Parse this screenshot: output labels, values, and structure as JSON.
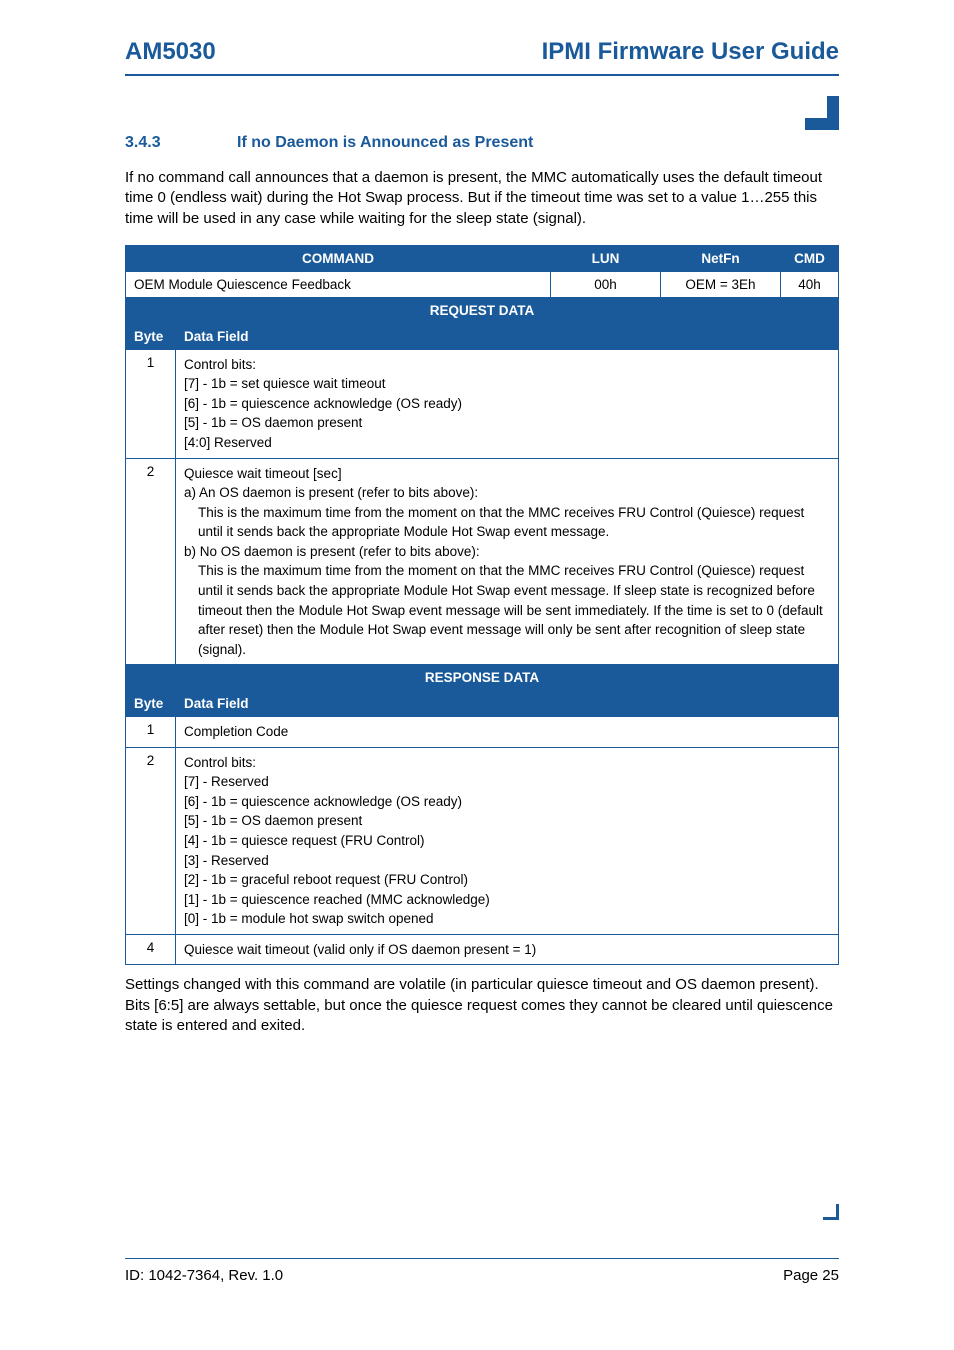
{
  "header": {
    "left": "AM5030",
    "right": "IPMI Firmware User Guide"
  },
  "section": {
    "num": "3.4.3",
    "title": "If no Daemon is Announced as Present"
  },
  "intro": "If no command call announces that a daemon is present, the MMC automatically uses the default timeout time 0 (endless wait) during the Hot Swap process. But if the timeout time was set to a value 1…255 this time will be used in any case while waiting for the sleep state (signal).",
  "table": {
    "hcols": {
      "c1": "COMMAND",
      "c2": "LUN",
      "c3": "NetFn",
      "c4": "CMD"
    },
    "row1": {
      "c1": "OEM Module Quiescence Feedback",
      "c2": "00h",
      "c3": "OEM = 3Eh",
      "c4": "40h"
    },
    "reqHeader": "REQUEST DATA",
    "byteLabel": "Byte",
    "fieldLabel": "Data Field",
    "req": [
      {
        "byte": "1",
        "lines": [
          "Control bits:",
          "[7] - 1b = set quiesce wait timeout",
          "[6] - 1b = quiescence acknowledge (OS ready)",
          "[5] - 1b = OS daemon present",
          "[4:0] Reserved"
        ]
      },
      {
        "byte": "2",
        "lines": [
          "Quiesce wait timeout [sec]",
          "a)  An OS daemon is present (refer to bits above):",
          "This is the maximum time from the moment on that the MMC receives FRU Control (Quiesce) request until it sends back the appropriate Module Hot Swap event message.",
          "b)  No OS daemon is present (refer to bits above):",
          "This is the maximum time from the moment on that the MMC receives FRU Control (Quiesce) request until it sends back the appropriate Module Hot Swap event message. If sleep state is recognized before timeout then the Module Hot Swap event message will be sent immediately. If the time is set to 0 (default after reset) then the Module Hot Swap event message will only be sent after recognition of sleep state (signal)."
        ],
        "indents": [
          0,
          0,
          2,
          0,
          2
        ]
      }
    ],
    "respHeader": "RESPONSE DATA",
    "resp": [
      {
        "byte": "1",
        "lines": [
          "Completion Code"
        ]
      },
      {
        "byte": "2",
        "lines": [
          "Control bits:",
          "[7] - Reserved",
          "[6] - 1b = quiescence acknowledge (OS ready)",
          "[5] - 1b = OS daemon present",
          "[4] - 1b = quiesce request (FRU Control)",
          "[3] - Reserved",
          "[2] - 1b = graceful reboot request (FRU Control)",
          "[1] - 1b = quiescence reached (MMC acknowledge)",
          "[0] - 1b = module hot swap switch opened"
        ]
      },
      {
        "byte": "4",
        "lines": [
          "Quiesce wait timeout (valid only if OS daemon present = 1)"
        ]
      }
    ]
  },
  "outro": "Settings changed with this command are volatile (in particular quiesce timeout and OS daemon present). Bits [6:5] are always settable, but once the quiesce request comes they cannot be cleared until quiescence state is entered and exited.",
  "footer": {
    "left": "ID: 1042-7364, Rev. 1.0",
    "right": "Page 25"
  }
}
